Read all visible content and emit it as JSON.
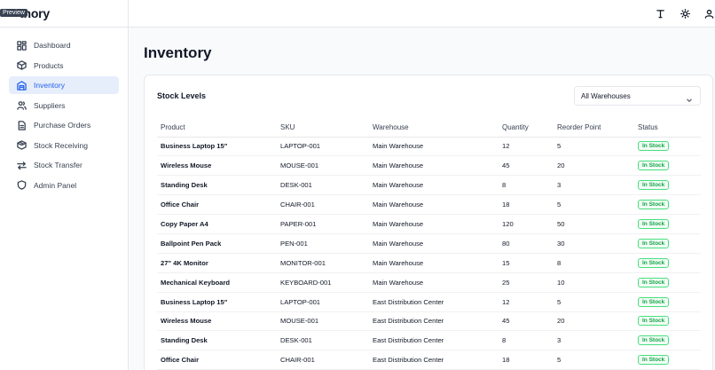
{
  "brand": {
    "name": "thory",
    "preview_label": "Preview"
  },
  "sidebar": {
    "items": [
      {
        "label": "Dashboard",
        "icon": "dashboard-icon",
        "active": false
      },
      {
        "label": "Products",
        "icon": "package-icon",
        "active": false
      },
      {
        "label": "Inventory",
        "icon": "warehouse-icon",
        "active": true
      },
      {
        "label": "Suppliers",
        "icon": "users-icon",
        "active": false
      },
      {
        "label": "Purchase Orders",
        "icon": "document-icon",
        "active": false
      },
      {
        "label": "Stock Receiving",
        "icon": "box-receive-icon",
        "active": false
      },
      {
        "label": "Stock Transfer",
        "icon": "transfer-arrows-icon",
        "active": false
      },
      {
        "label": "Admin Panel",
        "icon": "shield-icon",
        "active": false
      }
    ]
  },
  "topbar": {
    "icons": [
      "text-icon",
      "sun-icon",
      "user-icon"
    ]
  },
  "main": {
    "title": "Inventory",
    "card": {
      "title": "Stock Levels",
      "filter": {
        "selected": "All Warehouses"
      },
      "columns": [
        "Product",
        "SKU",
        "Warehouse",
        "Quantity",
        "Reorder Point",
        "Status"
      ],
      "rows": [
        [
          "Business Laptop 15\"",
          "LAPTOP-001",
          "Main Warehouse",
          "12",
          "5",
          "In Stock"
        ],
        [
          "Wireless Mouse",
          "MOUSE-001",
          "Main Warehouse",
          "45",
          "20",
          "In Stock"
        ],
        [
          "Standing Desk",
          "DESK-001",
          "Main Warehouse",
          "8",
          "3",
          "In Stock"
        ],
        [
          "Office Chair",
          "CHAIR-001",
          "Main Warehouse",
          "18",
          "5",
          "In Stock"
        ],
        [
          "Copy Paper A4",
          "PAPER-001",
          "Main Warehouse",
          "120",
          "50",
          "In Stock"
        ],
        [
          "Ballpoint Pen Pack",
          "PEN-001",
          "Main Warehouse",
          "80",
          "30",
          "In Stock"
        ],
        [
          "27\" 4K Monitor",
          "MONITOR-001",
          "Main Warehouse",
          "15",
          "8",
          "In Stock"
        ],
        [
          "Mechanical Keyboard",
          "KEYBOARD-001",
          "Main Warehouse",
          "25",
          "10",
          "In Stock"
        ],
        [
          "Business Laptop 15\"",
          "LAPTOP-001",
          "East Distribution Center",
          "12",
          "5",
          "In Stock"
        ],
        [
          "Wireless Mouse",
          "MOUSE-001",
          "East Distribution Center",
          "45",
          "20",
          "In Stock"
        ],
        [
          "Standing Desk",
          "DESK-001",
          "East Distribution Center",
          "8",
          "3",
          "In Stock"
        ],
        [
          "Office Chair",
          "CHAIR-001",
          "East Distribution Center",
          "18",
          "5",
          "In Stock"
        ]
      ]
    }
  },
  "colors": {
    "accent": "#2563eb",
    "active_bg": "#e6eefb",
    "status_green": "#16a34a"
  }
}
